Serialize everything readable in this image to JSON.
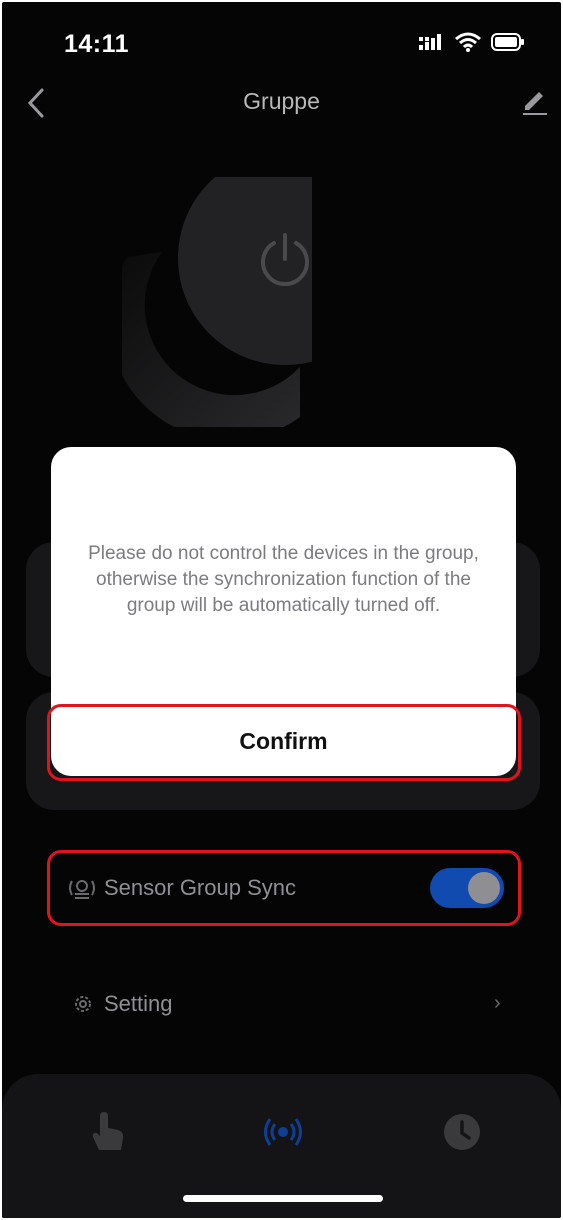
{
  "status_bar": {
    "time": "14:11"
  },
  "nav": {
    "title": "Gruppe",
    "back_icon": "chevron-left-icon",
    "edit_icon": "pencil-icon"
  },
  "dial": {
    "icon": "power-icon"
  },
  "rows": {
    "sensor_sync": {
      "label": "Sensor Group Sync",
      "icon": "sensor-sync-icon",
      "enabled": true
    },
    "setting": {
      "label": "Setting",
      "icon": "gear-icon",
      "chevron": "›"
    }
  },
  "tabs": [
    {
      "name": "touch",
      "icon": "hand-pointer-icon",
      "active": false
    },
    {
      "name": "sensor",
      "icon": "radio-waves-icon",
      "active": true
    },
    {
      "name": "schedule",
      "icon": "clock-icon",
      "active": false
    }
  ],
  "modal": {
    "message": "Please do not control the devices in the group, otherwise the synchronization function of the group will be automatically turned off.",
    "confirm_label": "Confirm"
  },
  "colors": {
    "background": "#050506",
    "accent": "#114bb0",
    "annotation": "#e0141e"
  }
}
